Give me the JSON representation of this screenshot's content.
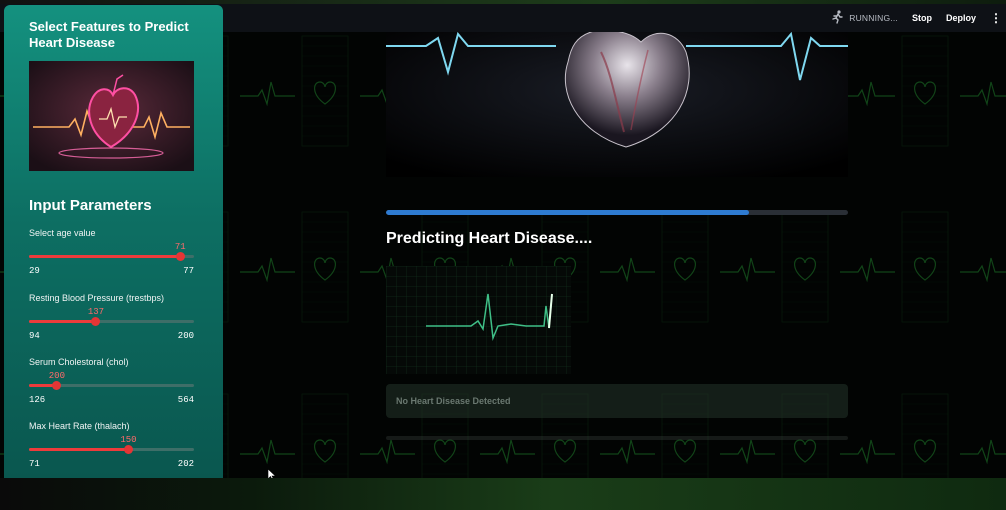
{
  "header": {
    "running_status": "RUNNING...",
    "stop_label": "Stop",
    "deploy_label": "Deploy",
    "menu_icon": "vertical-ellipsis-icon",
    "running_icon": "running-man-icon"
  },
  "sidebar": {
    "title": "Select Features to Predict Heart Disease",
    "image_icon": "neon-heart-ecg-illustration",
    "params_heading": "Input Parameters",
    "sliders": [
      {
        "label": "Select age value",
        "value": "71",
        "min": "29",
        "max": "77",
        "fraction": 0.9167
      },
      {
        "label": "Resting Blood Pressure (trestbps)",
        "value": "137",
        "min": "94",
        "max": "200",
        "fraction": 0.4057
      },
      {
        "label": "Serum Cholestoral (chol)",
        "value": "200",
        "min": "126",
        "max": "564",
        "fraction": 0.169
      },
      {
        "label": "Max Heart Rate (thalach)",
        "value": "150",
        "min": "71",
        "max": "202",
        "fraction": 0.603
      }
    ]
  },
  "main": {
    "hero_image": "anatomical-heart-with-ecg-illustration",
    "progress": 0.785,
    "status_heading": "Predicting Heart Disease....",
    "ecg_image": "ecg-monitor-animation",
    "result_text": "No Heart Disease Detected"
  },
  "colors": {
    "sidebar_top": "#14917f",
    "sidebar_bottom": "#0a574f",
    "slider_accent": "#ee3b3b",
    "progress_accent": "#2e7bd1",
    "background_pattern": "#1f7a2a"
  }
}
